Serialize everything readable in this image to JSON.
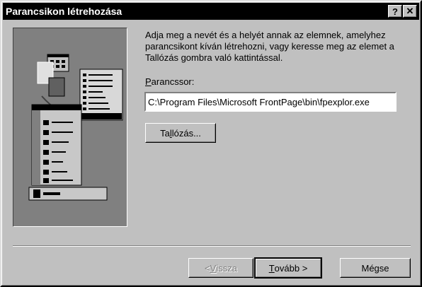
{
  "window": {
    "title": "Parancsikon létrehozása"
  },
  "titlebar_buttons": {
    "help": "?",
    "close": "✕"
  },
  "description": "Adja meg a nevét és a helyét annak az elemnek, amelyhez parancsikont kíván létrehozni, vagy keresse meg az elemet a Tallózás gombra való kattintással.",
  "command": {
    "label_first": "P",
    "label_rest": "arancssor:",
    "value": "C:\\Program Files\\Microsoft FrontPage\\bin\\fpexplor.exe"
  },
  "browse_button": {
    "label_prefix": "Ta",
    "label_accel": "l",
    "label_rest": "lózás..."
  },
  "buttons": {
    "back": {
      "label_prefix": "< ",
      "label_accel": "V",
      "label_rest": "issza"
    },
    "next": {
      "label_accel": "T",
      "label_rest": "ovább >"
    },
    "cancel": "Mégse"
  },
  "colors": {
    "titlebar": "#000000",
    "face": "#c0c0c0",
    "shadow": "#808080"
  }
}
